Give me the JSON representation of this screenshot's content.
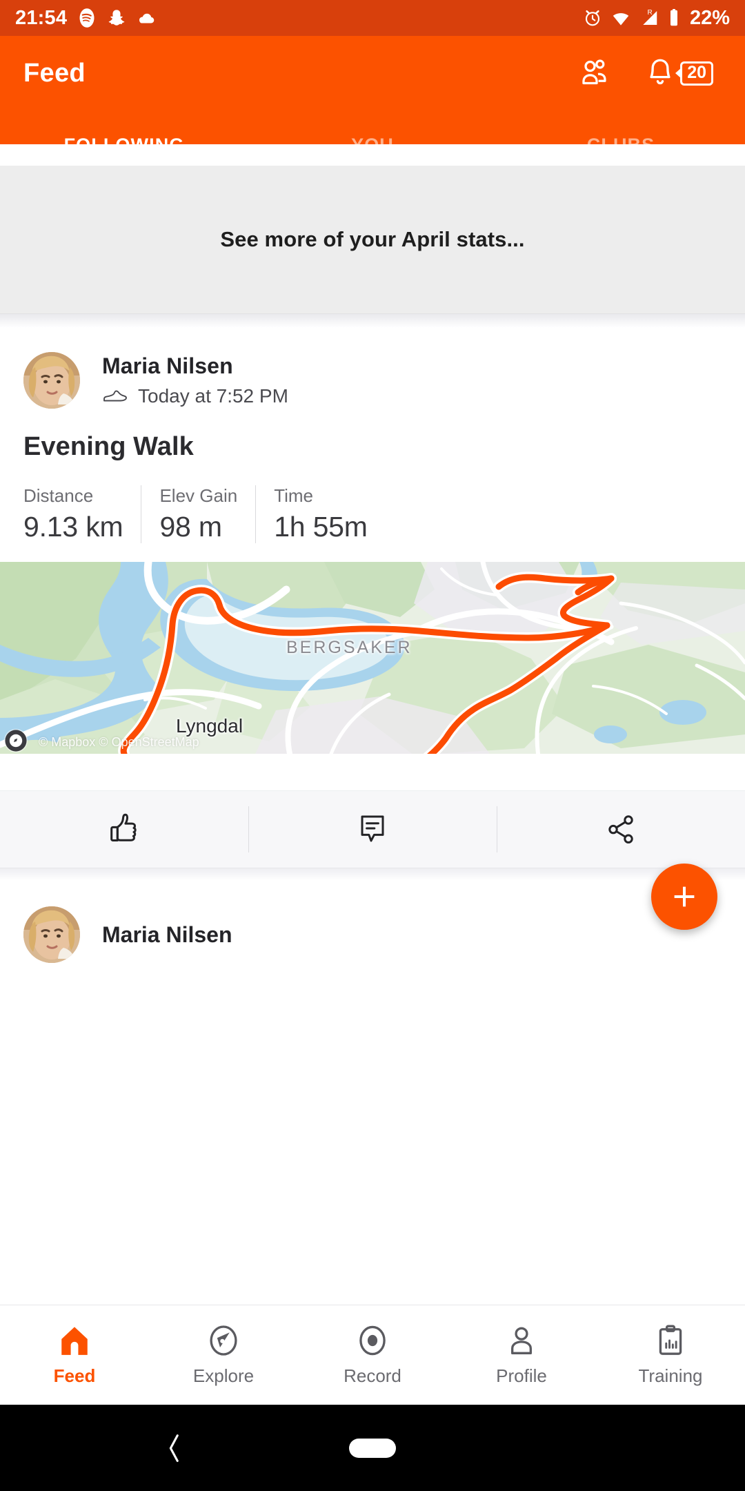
{
  "statusbar": {
    "time": "21:54",
    "battery": "22%",
    "left_icons": [
      "spotify-icon",
      "snapchat-icon",
      "cloud-icon"
    ],
    "right_icons": [
      "alarm-icon",
      "wifi-icon",
      "signal-roaming-icon",
      "battery-icon"
    ],
    "roaming_label": "R",
    "background": "#d8400c"
  },
  "appbar": {
    "title": "Feed",
    "accent": "#fc5200",
    "friends_icon": "friends-icon",
    "bell_icon": "bell-icon",
    "notification_count": "20"
  },
  "tabs": [
    {
      "label": "FOLLOWING",
      "active": true
    },
    {
      "label": "YOU",
      "active": false
    },
    {
      "label": "CLUBS",
      "active": false
    }
  ],
  "promo": {
    "text": "See more of your April stats..."
  },
  "activity": {
    "athlete_name": "Maria Nilsen",
    "activity_type_icon": "walking-shoe-icon",
    "timestamp": "Today at 7:52 PM",
    "title": "Evening Walk",
    "stats": [
      {
        "label": "Distance",
        "value": "9.13 km"
      },
      {
        "label": "Elev Gain",
        "value": "98 m"
      },
      {
        "label": "Time",
        "value": "1h 55m"
      }
    ],
    "map": {
      "attribution": "© Mapbox © OpenStreetMap",
      "route_color": "#fc4c02",
      "labels": [
        {
          "text": "BERGSAKER",
          "kind": "district"
        },
        {
          "text": "Lyngdal",
          "kind": "town"
        }
      ]
    },
    "actions": [
      {
        "icon": "thumbs-up-icon",
        "name": "kudos"
      },
      {
        "icon": "comment-icon",
        "name": "comment"
      },
      {
        "icon": "share-icon",
        "name": "share"
      }
    ]
  },
  "next_activity": {
    "athlete_name": "Maria Nilsen"
  },
  "fab": {
    "icon": "plus-icon",
    "color": "#fc5200"
  },
  "bottomnav": [
    {
      "label": "Feed",
      "icon": "home-icon",
      "active": true
    },
    {
      "label": "Explore",
      "icon": "compass-icon",
      "active": false
    },
    {
      "label": "Record",
      "icon": "record-icon",
      "active": false
    },
    {
      "label": "Profile",
      "icon": "person-icon",
      "active": false
    },
    {
      "label": "Training",
      "icon": "clipboard-chart-icon",
      "active": false
    }
  ],
  "androidnav": {
    "back_icon": "back-chevron-icon",
    "home_icon": "home-pill-icon"
  }
}
